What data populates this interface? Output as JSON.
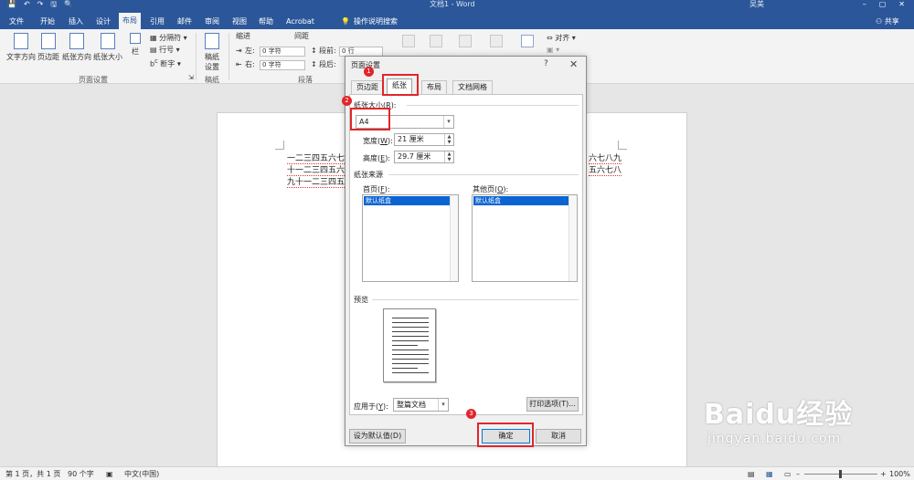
{
  "titlebar": {
    "title": "文档1 - Word",
    "user": "吴美",
    "qat": [
      "💾",
      "↶",
      "↷",
      "🖫",
      "🔍"
    ]
  },
  "tabs": [
    {
      "label": "文件"
    },
    {
      "label": "开始"
    },
    {
      "label": "插入"
    },
    {
      "label": "设计"
    },
    {
      "label": "布局",
      "active": true
    },
    {
      "label": "引用"
    },
    {
      "label": "邮件"
    },
    {
      "label": "审阅"
    },
    {
      "label": "视图"
    },
    {
      "label": "帮助"
    },
    {
      "label": "Acrobat"
    }
  ],
  "tell_me": "操作说明搜索",
  "share": "共享",
  "ribbon": {
    "text_direction": "文字方向",
    "margins": "页边距",
    "orientation": "纸张方向",
    "size": "纸张大小",
    "columns": "栏",
    "breaks": "分隔符",
    "line_numbers": "行号",
    "hyphenation": "断字",
    "draft_paper": "稿纸\n设置",
    "group_page_setup": "页面设置",
    "group_draft": "稿纸",
    "group_paragraph": "段落",
    "indent": "缩进",
    "spacing": "间距",
    "indent_left_label": "左:",
    "indent_left_value": "0 字符",
    "indent_right_label": "右:",
    "indent_right_value": "0 字符",
    "before_label": "段前:",
    "before_value": "0 行",
    "after_label": "段后:",
    "align": "对齐"
  },
  "document": {
    "line1": "一二三四五六七",
    "line2": "十一二三四五六",
    "line3": "九十一二三四五",
    "line1_right": "六七八九",
    "line2_right": "五六七八"
  },
  "dialog": {
    "title": "页面设置",
    "help": "?",
    "close": "✕",
    "tabs": [
      {
        "label": "页边距"
      },
      {
        "label": "纸张",
        "active": true
      },
      {
        "label": "布局"
      },
      {
        "label": "文档网格"
      }
    ],
    "paper_size_label": "纸张大小(",
    "paper_size_key": "R",
    "paper_size_value": "A4",
    "width_label": "宽度(",
    "width_key": "W",
    "width_value": "21 厘米",
    "height_label": "高度(",
    "height_key": "E",
    "height_value": "29.7 厘米",
    "paper_source": "纸张来源",
    "first_page_label": "首页(",
    "first_page_key": "F",
    "other_pages_label": "其他页(",
    "other_pages_key": "O",
    "default_tray": "默认纸盒",
    "preview": "预览",
    "apply_to_label": "应用于(",
    "apply_to_key": "Y",
    "apply_to_value": "整篇文档",
    "print_options": "打印选项(T)...",
    "set_default": "设为默认值(D)",
    "ok": "确定",
    "cancel": "取消"
  },
  "annotations": [
    "1",
    "2",
    "3"
  ],
  "statusbar": {
    "page": "第 1 页，共 1 页",
    "words": "90 个字",
    "language": "中文(中国)",
    "zoom": "100%"
  },
  "watermark": {
    "brand": "Baidu经验",
    "url": "jingyan.baidu.com"
  },
  "colors": {
    "ribbon_blue": "#2b579a",
    "annotation_red": "#e0262b",
    "selection_blue": "#0a64d2"
  }
}
